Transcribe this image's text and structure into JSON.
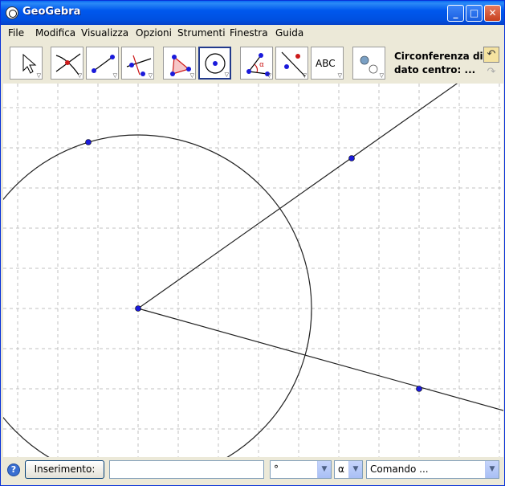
{
  "window": {
    "title": "GeoGebra",
    "buttons": {
      "minimize": "_",
      "maximize": "□",
      "close": "✕"
    }
  },
  "menu": [
    "File",
    "Modifica",
    "Visualizza",
    "Opzioni",
    "Strumenti",
    "Finestra",
    "Guida"
  ],
  "toolbar": {
    "tools": [
      {
        "name": "move-tool-icon"
      },
      {
        "name": "intersect-tool-icon"
      },
      {
        "name": "segment-tool-icon"
      },
      {
        "name": "perpendicular-tool-icon"
      },
      {
        "name": "polygon-tool-icon"
      },
      {
        "name": "circle-center-tool-icon",
        "selected": true
      },
      {
        "name": "angle-tool-icon"
      },
      {
        "name": "reflect-tool-icon"
      },
      {
        "name": "text-tool-icon",
        "label": "ABC"
      },
      {
        "name": "slider-tool-icon"
      }
    ],
    "help_line1": "Circonferenza di",
    "help_line2": "dato centro: ..."
  },
  "input_bar": {
    "help": "?",
    "input_button": "Inserimento:",
    "input_value": "",
    "degree_combo": "°",
    "greek_combo": "α",
    "command_combo": "Comando ..."
  },
  "colors": {
    "point": "#1a1adb",
    "grid": "#c0c0c0",
    "selected_tool": "#223a8c"
  }
}
